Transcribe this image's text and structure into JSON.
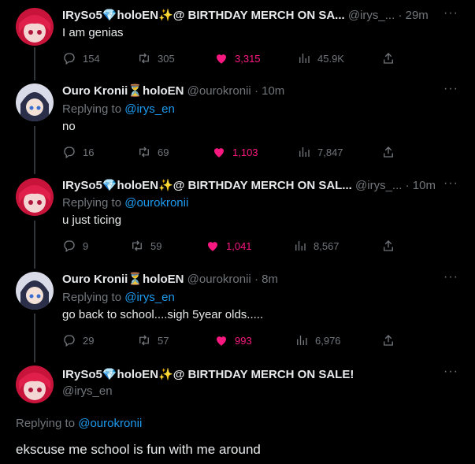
{
  "tweets": [
    {
      "name": "IRySo5💎holoEN✨@ BIRTHDAY MERCH ON SA...",
      "handle": "@irys_...",
      "time": "29m",
      "reply_prefix": "",
      "reply_to": "",
      "text": "I am genias",
      "replies": "154",
      "retweets": "305",
      "likes": "3,315",
      "views": "45.9K"
    },
    {
      "name": "Ouro Kronii⏳holoEN",
      "handle": "@ourokronii",
      "time": "10m",
      "reply_prefix": "Replying to",
      "reply_to": "@irys_en",
      "text": "no",
      "replies": "16",
      "retweets": "69",
      "likes": "1,103",
      "views": "7,847"
    },
    {
      "name": "IRySo5💎holoEN✨@ BIRTHDAY MERCH ON SAL...",
      "handle": "@irys_...",
      "time": "10m",
      "reply_prefix": "Replying to",
      "reply_to": "@ourokronii",
      "text": "u just ticing",
      "replies": "9",
      "retweets": "59",
      "likes": "1,041",
      "views": "8,567"
    },
    {
      "name": "Ouro Kronii⏳holoEN",
      "handle": "@ourokronii",
      "time": "8m",
      "reply_prefix": "Replying to",
      "reply_to": "@irys_en",
      "text": "go back to school....sigh 5year olds.....",
      "replies": "29",
      "retweets": "57",
      "likes": "993",
      "views": "6,976"
    }
  ],
  "main_tweet": {
    "name": "IRySo5💎holoEN✨@ BIRTHDAY MERCH ON SALE!",
    "handle": "@irys_en",
    "reply_prefix": "Replying to",
    "reply_to": "@ourokronii",
    "text": "ekscuse me school is fun with me around"
  },
  "dot": "·",
  "colors": {
    "like": "#f91880",
    "link": "#1d9bf0",
    "muted": "#71767b"
  }
}
